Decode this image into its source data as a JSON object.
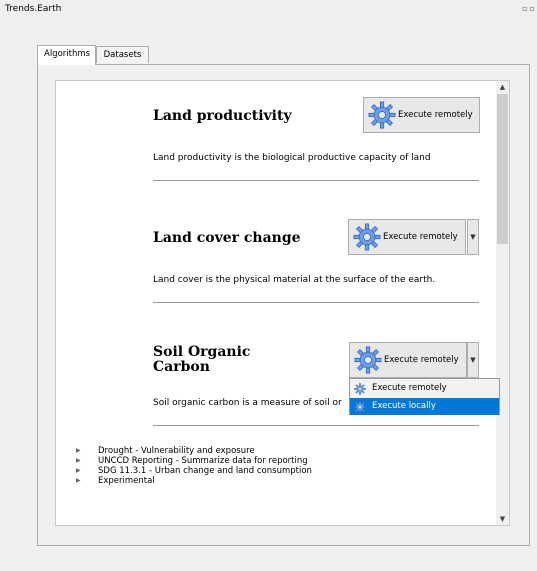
{
  "window": {
    "title": "Trends.Earth"
  },
  "tabs": [
    {
      "label": "Algorithms"
    },
    {
      "label": "Datasets"
    }
  ],
  "algorithms": [
    {
      "title": "Land productivity",
      "description": "Land productivity is the biological productive capacity of land",
      "button_label": "Execute remotely"
    },
    {
      "title": "Land cover change",
      "description": "Land cover is the physical material at the surface of the earth.",
      "button_label": "Execute remotely"
    },
    {
      "title_line1": "Soil Organic",
      "title_line2": "Carbon",
      "description": "Soil organic carbon is a measure of soil or",
      "button_label": "Execute remotely"
    }
  ],
  "dropdown_menu": [
    {
      "label": "Execute remotely"
    },
    {
      "label": "Execute locally"
    }
  ],
  "tree": [
    {
      "label": "Drought - Vulnerability and exposure"
    },
    {
      "label": "UNCCD Reporting - Summarize data for reporting"
    },
    {
      "label": "SDG 11.3.1 - Urban change and land consumption"
    },
    {
      "label": "Experimental"
    }
  ],
  "colors": {
    "selection": "#0078d7",
    "gear_blue": "#4a7fd4"
  },
  "icons": {
    "gear": "gear-icon",
    "arrow": "chevron-right-icon",
    "dropdown": "chevron-down-icon"
  }
}
